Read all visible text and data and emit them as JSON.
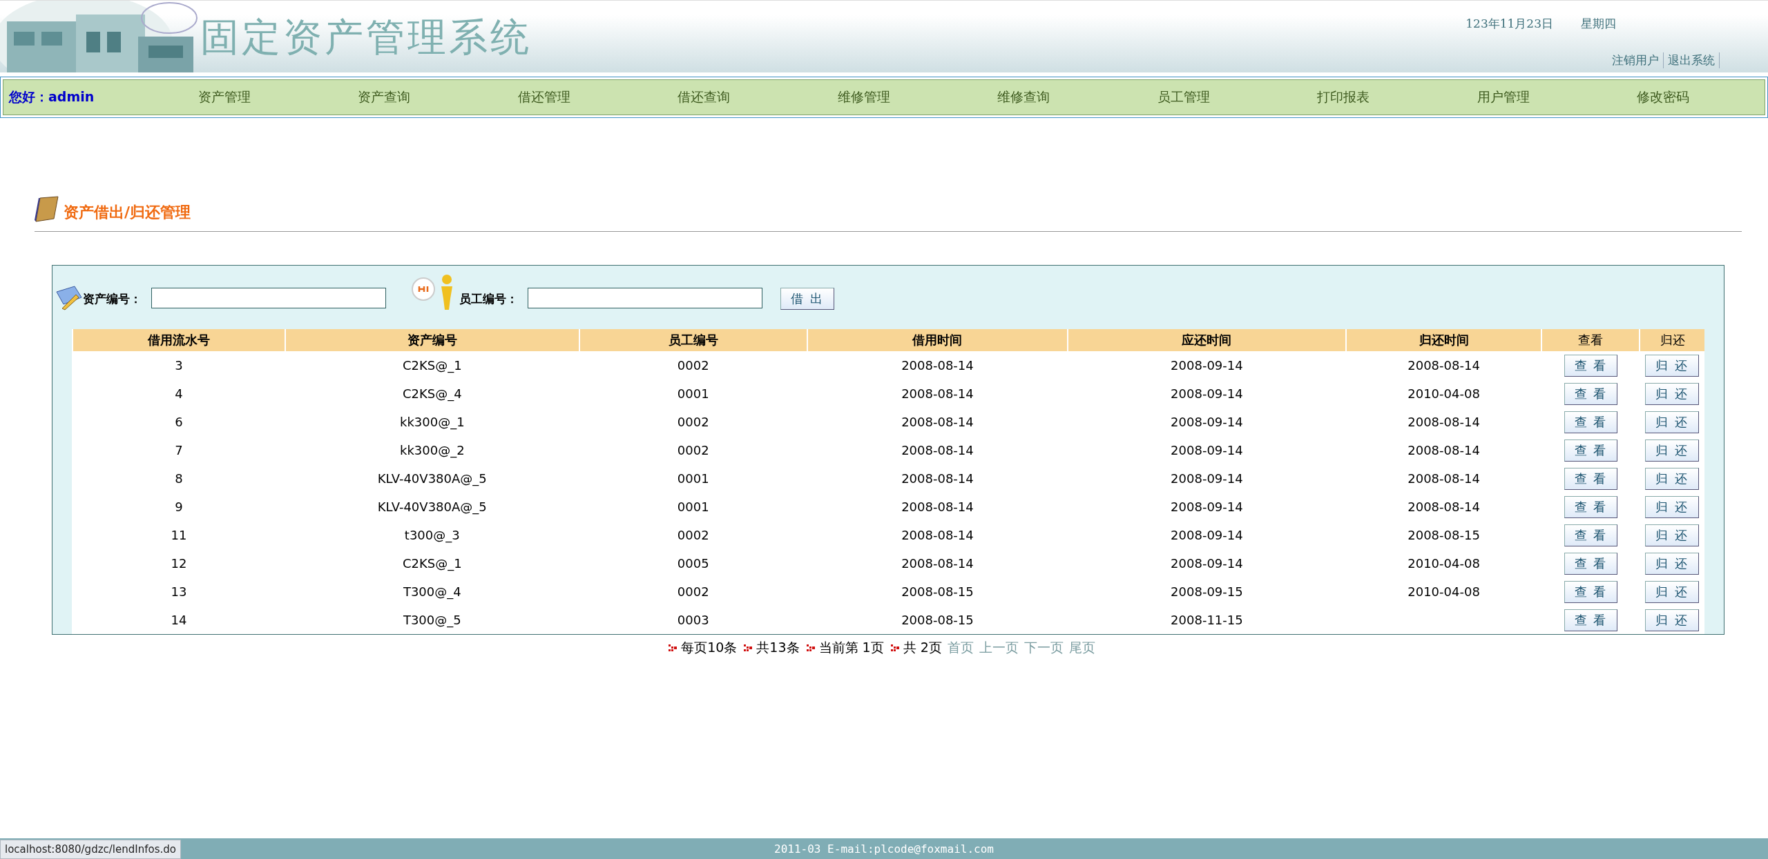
{
  "header": {
    "title": "固定资产管理系统",
    "date": "123年11月23日",
    "weekday": "星期四",
    "links": [
      "注销用户",
      "退出系统"
    ]
  },
  "nav": {
    "greeting_label": "您好：",
    "user": "admin",
    "items": [
      "资产管理",
      "资产查询",
      "借还管理",
      "借还查询",
      "维修管理",
      "维修查询",
      "员工管理",
      "打印报表",
      "用户管理",
      "修改密码"
    ]
  },
  "page_title": "资产借出/归还管理",
  "form": {
    "asset_label": "资产编号：",
    "employee_label": "员工编号：",
    "button": "借 出"
  },
  "table": {
    "columns": [
      {
        "label": "借用流水号",
        "bold": true
      },
      {
        "label": "资产编号",
        "bold": true
      },
      {
        "label": "员工编号",
        "bold": true
      },
      {
        "label": "借用时间",
        "bold": true
      },
      {
        "label": "应还时间",
        "bold": true
      },
      {
        "label": "归还时间",
        "bold": true
      },
      {
        "label": "查看",
        "bold": false
      },
      {
        "label": "归还",
        "bold": false
      }
    ],
    "rows": [
      {
        "cells": [
          "3",
          "C2KS@_1",
          "0002",
          "2008-08-14",
          "2008-09-14",
          "2008-08-14"
        ],
        "view": "查 看",
        "return": "归 还"
      },
      {
        "cells": [
          "4",
          "C2KS@_4",
          "0001",
          "2008-08-14",
          "2008-09-14",
          "2010-04-08"
        ],
        "view": "查 看",
        "return": "归 还"
      },
      {
        "cells": [
          "6",
          "kk300@_1",
          "0002",
          "2008-08-14",
          "2008-09-14",
          "2008-08-14"
        ],
        "view": "查 看",
        "return": "归 还"
      },
      {
        "cells": [
          "7",
          "kk300@_2",
          "0002",
          "2008-08-14",
          "2008-09-14",
          "2008-08-14"
        ],
        "view": "查 看",
        "return": "归 还"
      },
      {
        "cells": [
          "8",
          "KLV-40V380A@_5",
          "0001",
          "2008-08-14",
          "2008-09-14",
          "2008-08-14"
        ],
        "view": "查 看",
        "return": "归 还"
      },
      {
        "cells": [
          "9",
          "KLV-40V380A@_5",
          "0001",
          "2008-08-14",
          "2008-09-14",
          "2008-08-14"
        ],
        "view": "查 看",
        "return": "归 还"
      },
      {
        "cells": [
          "11",
          "t300@_3",
          "0002",
          "2008-08-14",
          "2008-09-14",
          "2008-08-15"
        ],
        "view": "查 看",
        "return": "归 还"
      },
      {
        "cells": [
          "12",
          "C2KS@_1",
          "0005",
          "2008-08-14",
          "2008-09-14",
          "2010-04-08"
        ],
        "view": "查 看",
        "return": "归 还"
      },
      {
        "cells": [
          "13",
          "T300@_4",
          "0002",
          "2008-08-15",
          "2008-09-15",
          "2010-04-08"
        ],
        "view": "查 看",
        "return": "归 还"
      },
      {
        "cells": [
          "14",
          "T300@_5",
          "0003",
          "2008-08-15",
          "2008-11-15",
          null
        ],
        "view": "查 看",
        "return": "归 还"
      }
    ]
  },
  "pagination": {
    "info": [
      "每页10条",
      "共13条",
      "当前第 1页",
      "共 2页"
    ],
    "links": [
      "首页",
      "上一页",
      "下一页",
      "尾页"
    ]
  },
  "footer": "2011-03 E-mail:plcode@foxmail.com",
  "status_bar": "localhost:8080/gdzc/lendInfos.do"
}
